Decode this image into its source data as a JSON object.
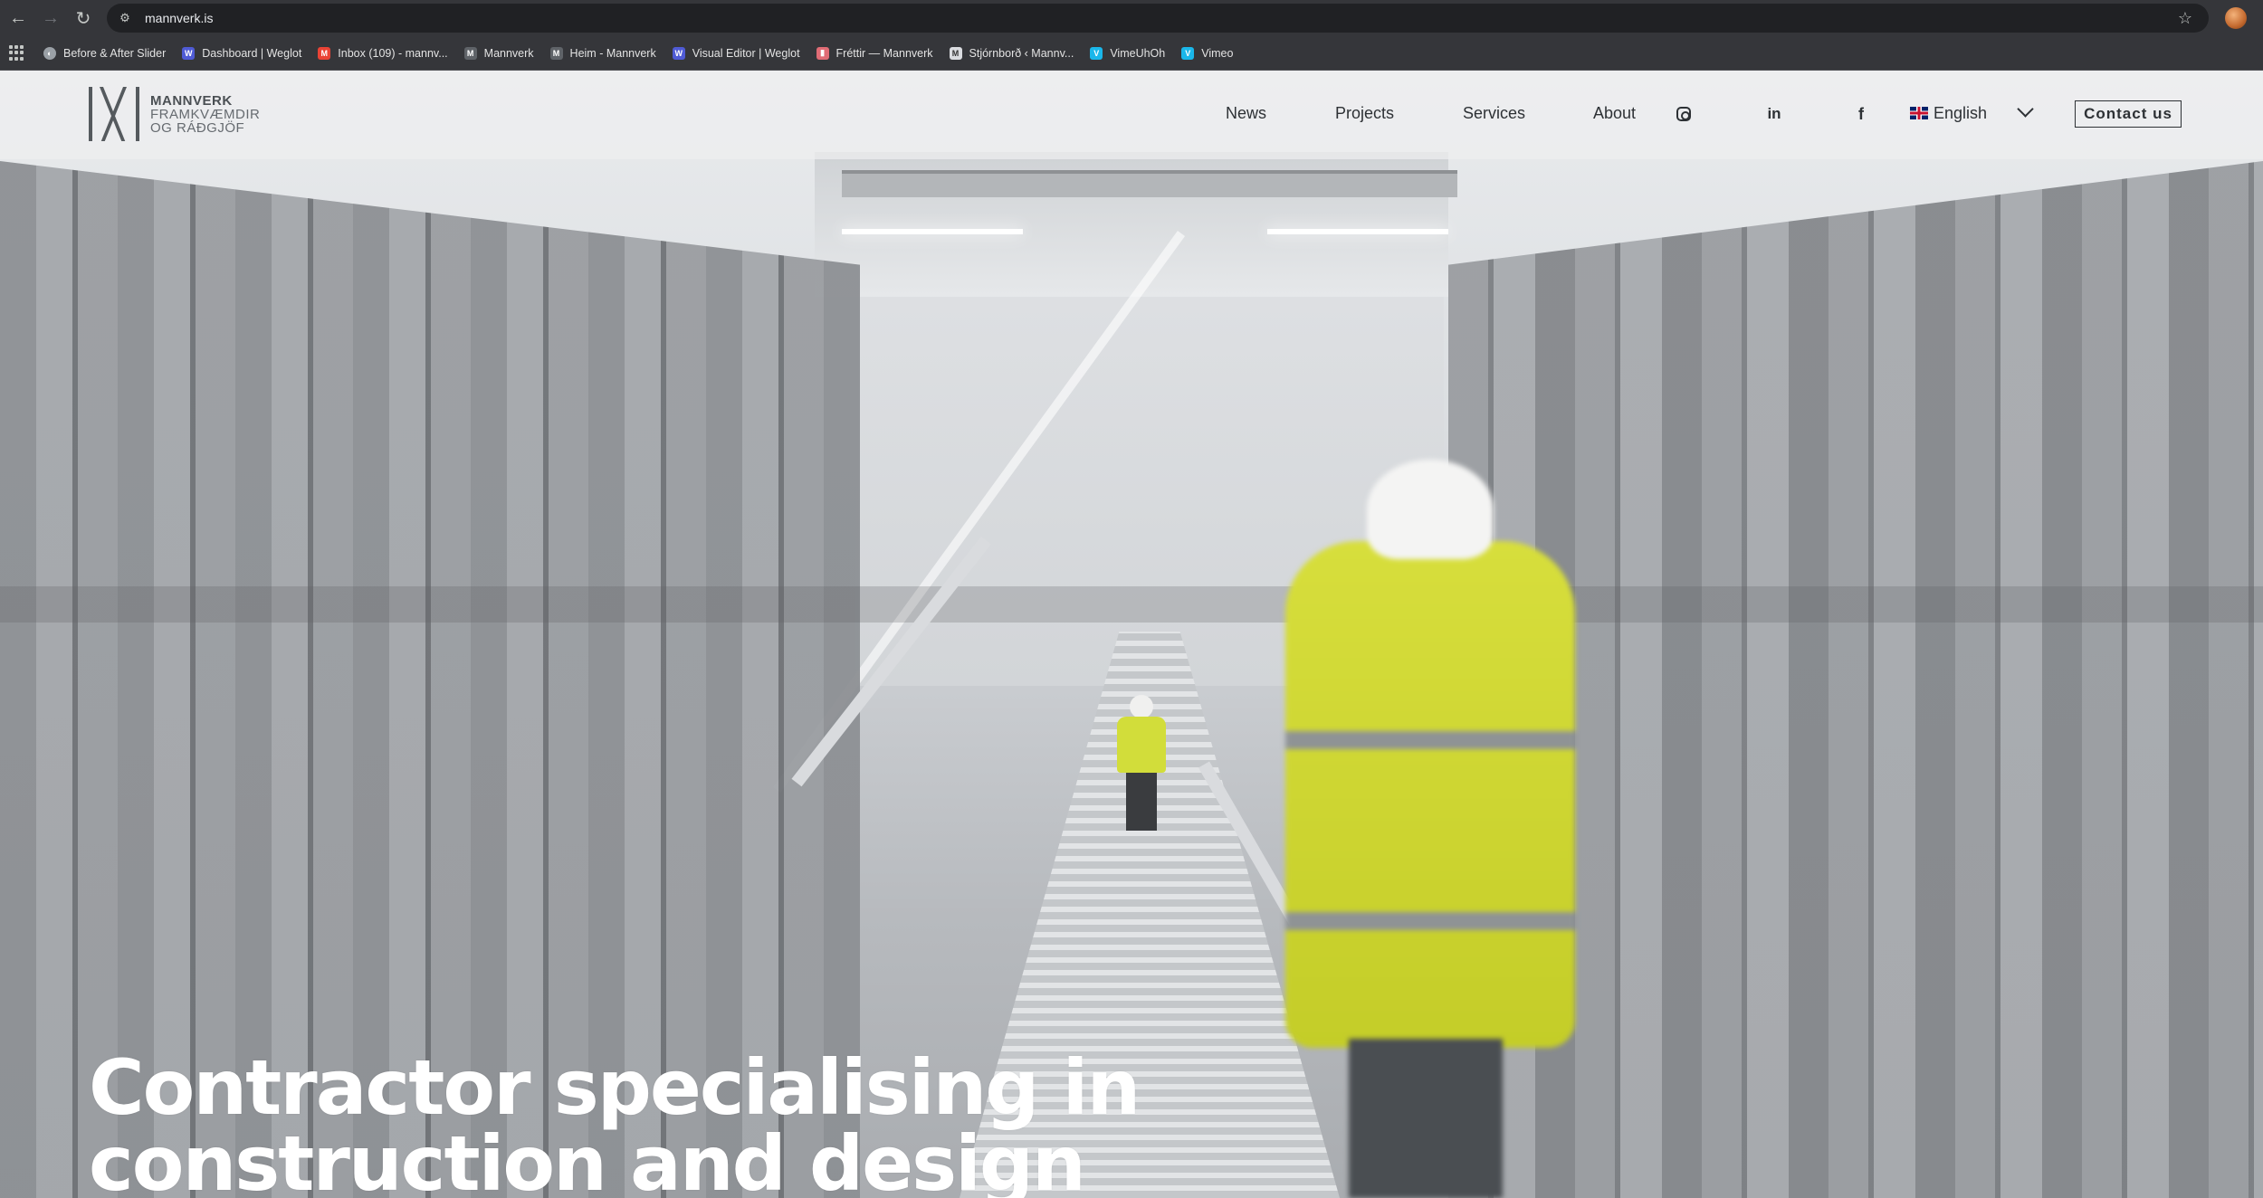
{
  "browser": {
    "url": "mannverk.is",
    "bookmarks": [
      {
        "label": "Before & After Slider",
        "icon": "globe-icon",
        "color": "#9aa0a6"
      },
      {
        "label": "Dashboard | Weglot",
        "icon": "weglot-icon",
        "color": "#4f5bd5"
      },
      {
        "label": "Inbox (109) - mannv...",
        "icon": "gmail-icon",
        "color": "#ea4335"
      },
      {
        "label": "Mannverk",
        "icon": "mannverk-icon",
        "color": "#5f6368"
      },
      {
        "label": "Heim - Mannverk",
        "icon": "mannverk-icon",
        "color": "#5f6368"
      },
      {
        "label": "Visual Editor | Weglot",
        "icon": "weglot-icon",
        "color": "#4f5bd5"
      },
      {
        "label": "Fréttir — Mannverk",
        "icon": "bookmark-red-icon",
        "color": "#e06c75"
      },
      {
        "label": "Stjórnborð ‹ Mannv...",
        "icon": "m-icon",
        "color": "#dadce0"
      },
      {
        "label": "VimeUhOh",
        "icon": "vimeo-icon",
        "color": "#1ab7ea"
      },
      {
        "label": "Vimeo",
        "icon": "vimeo-icon",
        "color": "#1ab7ea"
      }
    ]
  },
  "header": {
    "logo": {
      "line1": "MANNVERK",
      "line2": "FRAMKVÆMDIR",
      "line3": "OG RÁÐGJÖF"
    },
    "nav": [
      "News",
      "Projects",
      "Services",
      "About"
    ],
    "social": [
      "instagram-icon",
      "linkedin-icon",
      "facebook-icon"
    ],
    "language": "English",
    "contact": "Contact us"
  },
  "hero": {
    "headline_line1": "Contractor specialising in",
    "headline_line2": "construction and design"
  },
  "colors": {
    "accent": "#d7de3c",
    "text": "#2d3135",
    "chrome": "#35363a"
  }
}
